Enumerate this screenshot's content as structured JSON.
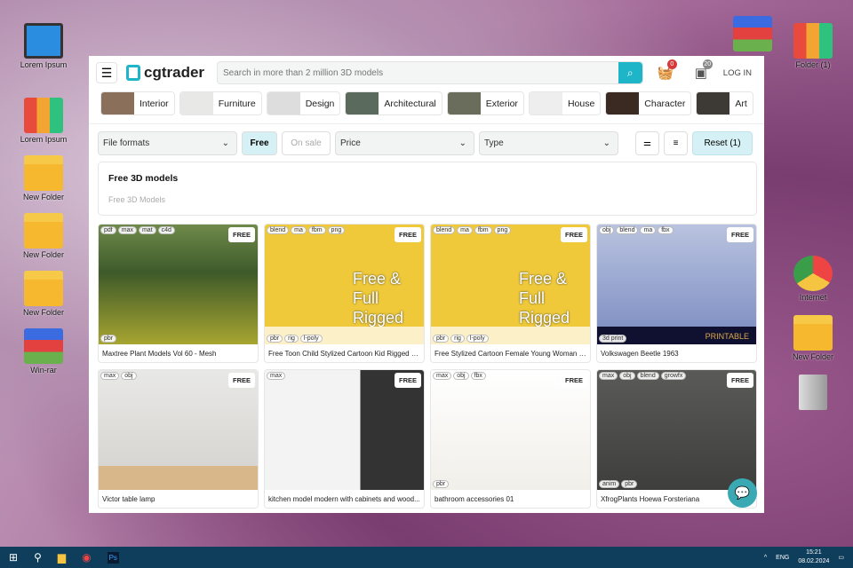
{
  "desktop": {
    "left": [
      {
        "label": "Lorem Ipsum",
        "icon": "monitor-icon"
      },
      {
        "label": "Lorem Ipsum",
        "icon": "binder-icon"
      },
      {
        "label": "New Folder",
        "icon": "folder-icon"
      },
      {
        "label": "New Folder",
        "icon": "folder-icon"
      },
      {
        "label": "New Folder",
        "icon": "folder-icon"
      },
      {
        "label": "Win-rar",
        "icon": "winrar-icon"
      }
    ],
    "right": [
      {
        "label": "Folder (1)",
        "icon": "binder-icon"
      },
      {
        "label": "Internet",
        "icon": "chrome-icon"
      },
      {
        "label": "New Folder",
        "icon": "folder-icon"
      }
    ]
  },
  "header": {
    "logo": "cgtrader",
    "search_placeholder": "Search in more than 2 million 3D models",
    "cart_count": "0",
    "downloads_count": "20",
    "login": "LOG IN"
  },
  "categories": [
    "Interior",
    "Furniture",
    "Design",
    "Architectural",
    "Exterior",
    "House",
    "Character",
    "Art"
  ],
  "filters": {
    "file_formats": "File formats",
    "free": "Free",
    "on_sale": "On sale",
    "price": "Price",
    "type": "Type",
    "reset": "Reset (1)"
  },
  "info": {
    "title": "Free 3D models",
    "subtitle": "Free 3D Models"
  },
  "free_label": "FREE",
  "cards": [
    {
      "title": "Maxtree Plant Models Vol 60 - Mesh",
      "tags": [
        "pdf",
        "max",
        "mat",
        "c4d"
      ],
      "bottom_tags": [
        "pbr"
      ]
    },
    {
      "title": "Free Toon Child Stylized Cartoon Kid Rigged Ba...",
      "tags": [
        "blend",
        "ma",
        "fbm",
        "png"
      ],
      "bottom_tags": [
        "pbr",
        "rig",
        "l-poly"
      ],
      "overlay": "Free & Full Rigged"
    },
    {
      "title": "Free Stylized Cartoon Female Young Woman wi...",
      "tags": [
        "blend",
        "ma",
        "fbm",
        "png"
      ],
      "bottom_tags": [
        "pbr",
        "rig",
        "l-poly"
      ],
      "overlay": "Free & Full Rigged"
    },
    {
      "title": "Volkswagen Beetle 1963",
      "tags": [
        "obj",
        "blend",
        "ma",
        "fbx"
      ],
      "bottom_tags": [
        "3d print"
      ],
      "overlay": "PRINTABLE"
    },
    {
      "title": "Victor table lamp",
      "tags": [
        "max",
        "obj"
      ],
      "bottom_tags": []
    },
    {
      "title": "kitchen model modern with cabinets and wood...",
      "tags": [
        "max"
      ],
      "bottom_tags": []
    },
    {
      "title": "bathroom accessories 01",
      "tags": [
        "max",
        "obj",
        "fbx"
      ],
      "bottom_tags": [
        "pbr"
      ]
    },
    {
      "title": "XfrogPlants Hoewa Forsteriana",
      "tags": [
        "max",
        "obj",
        "blend",
        "growfx"
      ],
      "bottom_tags": [
        "anim",
        "pbr"
      ]
    }
  ],
  "taskbar": {
    "lang": "ENG",
    "time": "15:21",
    "date": "08.02.2024"
  }
}
